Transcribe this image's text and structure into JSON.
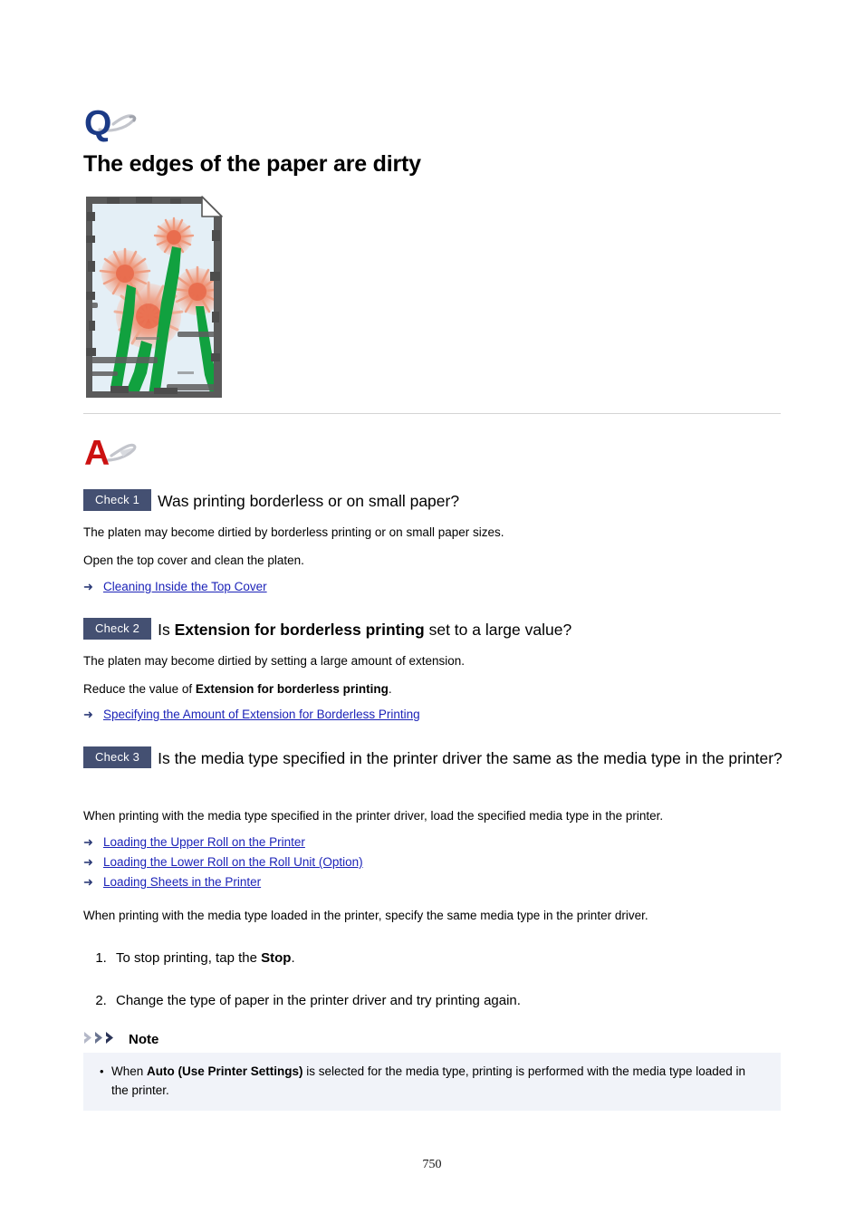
{
  "document": {
    "title": "The edges of the paper are dirty",
    "page_number": "750"
  },
  "question_icon": {
    "letter": "Q",
    "color": "#1b3a86",
    "swoosh_color": "#b9bbc2",
    "name": "question-marker"
  },
  "answer_icon": {
    "letter": "A",
    "color": "#cc1111",
    "swoosh_color": "#b9bbc2",
    "name": "answer-marker"
  },
  "illustration": {
    "alt": "Printed page with dirty smudged edges showing orange flowers",
    "paper_color": "#e3eef5",
    "smudge_color": "#575757",
    "flower_color": "#f0845f",
    "stem_color": "#109c3c"
  },
  "checks": [
    {
      "badge": "Check 1",
      "question_parts": [
        {
          "text": "Was printing borderless or on small paper?",
          "bold": false
        }
      ],
      "paragraphs": [
        [
          {
            "text": "The platen may become dirtied by borderless printing or on small paper sizes.",
            "bold": false
          }
        ],
        [
          {
            "text": "Open the top cover and clean the platen.",
            "bold": false
          }
        ]
      ],
      "links": [
        {
          "label": "Cleaning Inside the Top Cover",
          "arrow": "➜"
        }
      ]
    },
    {
      "badge": "Check 2",
      "question_parts": [
        {
          "text": "Is ",
          "bold": false
        },
        {
          "text": "Extension for borderless printing",
          "bold": true
        },
        {
          "text": " set to a large value?",
          "bold": false
        }
      ],
      "paragraphs": [
        [
          {
            "text": "The platen may become dirtied by setting a large amount of extension.",
            "bold": false
          }
        ],
        [
          {
            "text": "Reduce the value of ",
            "bold": false
          },
          {
            "text": "Extension for borderless printing",
            "bold": true
          },
          {
            "text": ".",
            "bold": false
          }
        ]
      ],
      "links": [
        {
          "label": "Specifying the Amount of Extension for Borderless Printing",
          "arrow": "➜"
        }
      ]
    },
    {
      "badge": "Check 3",
      "question_parts": [
        {
          "text": "Is the media type specified in the printer driver the same as the media type in the printer?",
          "bold": false
        }
      ],
      "paragraphs": [
        [
          {
            "text": "When printing with the media type specified in the printer driver, load the specified media type in the printer.",
            "bold": false
          }
        ]
      ],
      "links": [
        {
          "label": "Loading the Upper Roll on the Printer",
          "arrow": "➜"
        },
        {
          "label": "Loading the Lower Roll on the Roll Unit (Option)",
          "arrow": "➜"
        },
        {
          "label": "Loading Sheets in the Printer",
          "arrow": "➜"
        }
      ],
      "trailing_paragraphs": [
        [
          {
            "text": "When printing with the media type loaded in the printer, specify the same media type in the printer driver.",
            "bold": false
          }
        ]
      ]
    }
  ],
  "steps": [
    [
      {
        "text": "To stop printing, tap the ",
        "bold": false
      },
      {
        "text": "Stop",
        "bold": true
      },
      {
        "text": ".",
        "bold": false
      }
    ],
    [
      {
        "text": "Change the type of paper in the printer driver and try printing again.",
        "bold": false
      }
    ]
  ],
  "note": {
    "title": "Note",
    "items": [
      [
        {
          "text": "When ",
          "bold": false
        },
        {
          "text": "Auto (Use Printer Settings)",
          "bold": true
        },
        {
          "text": " is selected for the media type, printing is performed with the media type loaded in the printer.",
          "bold": false
        }
      ]
    ],
    "bullet": "•",
    "background": "#f1f3f9"
  },
  "colors": {
    "badge_bg": "#445072",
    "link": "#1c23b8",
    "arrow": "#2b3a77",
    "divider": "#d4d4d4"
  }
}
